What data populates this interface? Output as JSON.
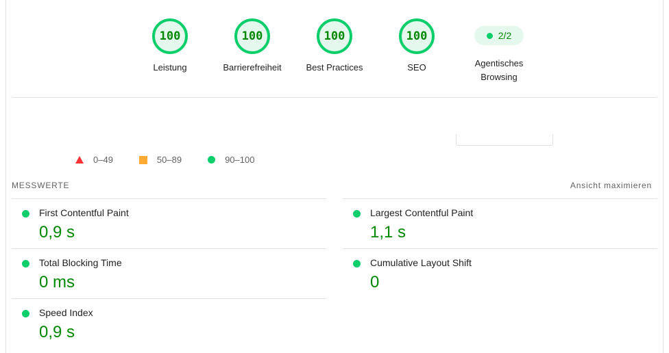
{
  "gauges": [
    {
      "score": "100",
      "label": "Leistung"
    },
    {
      "score": "100",
      "label": "Barrierefreiheit"
    },
    {
      "score": "100",
      "label": "Best Practices"
    },
    {
      "score": "100",
      "label": "SEO"
    }
  ],
  "agentic": {
    "value": "2/2",
    "label_line1": "Agentisches",
    "label_line2": "Browsing"
  },
  "legend": {
    "fail": "0–49",
    "average": "50–89",
    "pass": "90–100"
  },
  "metrics_section": {
    "title": "MESSWERTE",
    "expand_label": "Ansicht maximieren"
  },
  "metrics": [
    {
      "title": "First Contentful Paint",
      "value": "0,9 s"
    },
    {
      "title": "Largest Contentful Paint",
      "value": "1,1 s"
    },
    {
      "title": "Total Blocking Time",
      "value": "0 ms"
    },
    {
      "title": "Cumulative Layout Shift",
      "value": "0"
    },
    {
      "title": "Speed Index",
      "value": "0,9 s"
    }
  ],
  "colors": {
    "pass": "#0cce6b",
    "pass_text": "#008800",
    "average": "#ffaa33",
    "fail": "#ff3333"
  }
}
